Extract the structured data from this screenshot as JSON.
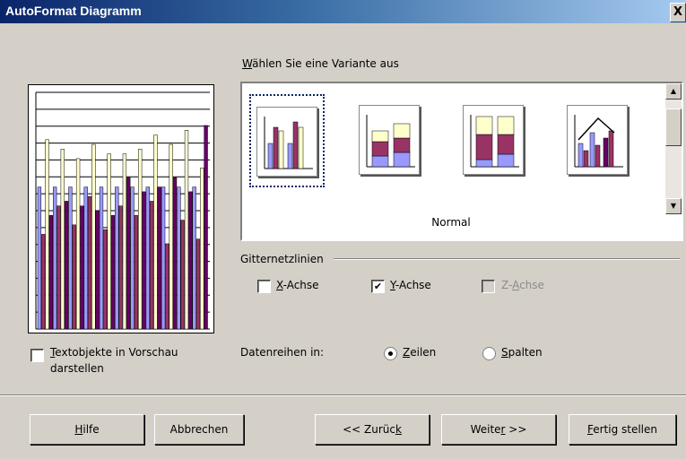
{
  "window": {
    "title": "AutoFormat Diagramm",
    "close_label": "X"
  },
  "variants": {
    "label_prefix": "",
    "label_accel": "W",
    "label_rest": "ählen Sie eine Variante aus",
    "selected_caption": "Normal",
    "items": [
      {
        "name": "normal",
        "selected": true
      },
      {
        "name": "stacked",
        "selected": false
      },
      {
        "name": "percent-stacked",
        "selected": false
      },
      {
        "name": "lines-and-columns",
        "selected": false
      }
    ]
  },
  "gridlines": {
    "label": "Gitternetzlinien",
    "x_axis": {
      "accel": "X",
      "rest": "-Achse",
      "checked": false,
      "enabled": true
    },
    "y_axis": {
      "accel": "Y",
      "rest": "-Achse",
      "checked": true,
      "enabled": true
    },
    "z_axis": {
      "pre": "Z-",
      "accel": "A",
      "rest": "chse",
      "checked": false,
      "enabled": false
    }
  },
  "preview_option": {
    "accel": "T",
    "rest": "extobjekte in Vorschau",
    "line2": "darstellen",
    "checked": false
  },
  "data_series": {
    "label": "Datenreihen in:",
    "rows": {
      "accel": "Z",
      "rest": "eilen",
      "selected": true
    },
    "columns": {
      "accel": "S",
      "rest": "palten",
      "selected": false
    }
  },
  "buttons": {
    "help": {
      "pre": "",
      "accel": "H",
      "rest": "ilfe"
    },
    "cancel": "Abbrechen",
    "back": {
      "pre": "<< Zurüc",
      "accel": "k",
      "rest": ""
    },
    "next": {
      "pre": "Weite",
      "accel": "r",
      "rest": " >>"
    },
    "finish": {
      "pre": "",
      "accel": "F",
      "rest": "ertig stellen"
    }
  },
  "colors": {
    "title_bar": "#0a246a",
    "dialog_bg": "#d4d0c8",
    "series1": "#9999ff",
    "series2": "#993366",
    "series3": "#ffffcc",
    "series4": "#660066"
  },
  "preview_chart": {
    "series1": [
      60,
      60,
      60,
      60,
      60,
      60,
      60,
      60,
      60,
      60,
      60
    ],
    "series2": [
      40,
      52,
      44,
      56,
      42,
      52,
      48,
      54,
      36,
      46,
      38
    ],
    "series3": [
      80,
      76,
      72,
      78,
      74,
      74,
      76,
      82,
      78,
      84,
      68
    ],
    "series4": [
      48,
      54,
      52,
      50,
      48,
      64,
      58,
      60,
      64,
      58,
      86
    ]
  }
}
